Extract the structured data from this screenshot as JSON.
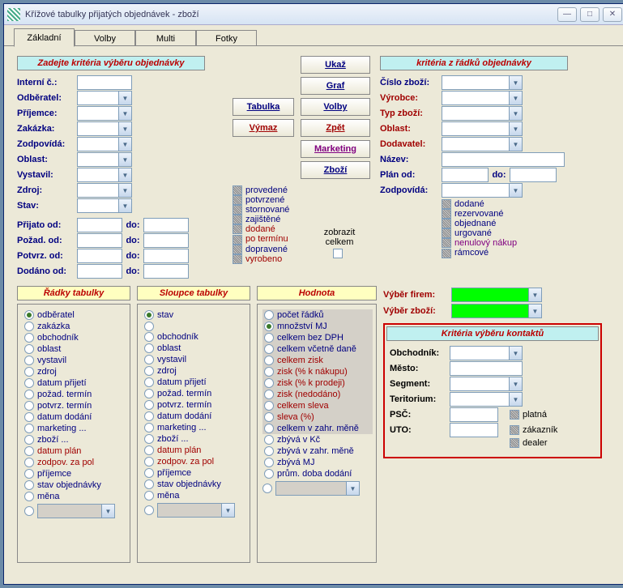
{
  "title": "Křížové tabulky přijatých objednávek - zboží",
  "tabs": [
    "Základní",
    "Volby",
    "Multi",
    "Fotky"
  ],
  "hdr_left": "Zadejte kritéria výběru objednávky",
  "hdr_right": "kritéria z řádků objednávky",
  "btns": {
    "ukaz": "Ukaž",
    "graf": "Graf",
    "tabulka": "Tabulka",
    "volby": "Volby",
    "vymaz": "Výmaz",
    "zpet": "Zpět",
    "marketing": "Marketing",
    "zbozi": "Zboží"
  },
  "left_labels": [
    "Interní č.:",
    "Odběratel:",
    "Příjemce:",
    "Zakázka:",
    "Zodpovídá:",
    "Oblast:",
    "Vystavil:",
    "Zdroj:",
    "Stav:"
  ],
  "date_labels": [
    "Přijato od:",
    "Požad. od:",
    "Potvrz. od:",
    "Dodáno od:"
  ],
  "do": "do:",
  "mid_checks": [
    "provedené",
    "potvrzené",
    "stornované",
    "zajištěné",
    "dodané",
    "po termínu",
    "dopravené",
    "vyrobeno"
  ],
  "zobrazit": "zobrazit celkem",
  "right_labels": [
    "Číslo zboží:",
    "Výrobce:",
    "Typ zboží:",
    "Oblast:",
    "Dodavatel:",
    "Název:",
    "Plán od:",
    "Zodpovídá:"
  ],
  "right_checks": [
    "dodané",
    "rezervované",
    "objednané",
    "urgované",
    "nenulový nákup",
    "rámcové"
  ],
  "col_hdr": [
    "Řádky tabulky",
    "Sloupce tabulky",
    "Hodnota"
  ],
  "vyber_firem": "Výběr firem:",
  "vyber_zbozi": "Výběr zboží:",
  "radky": [
    "odběratel",
    "zakázka",
    "obchodník",
    "oblast",
    "vystavil",
    "zdroj",
    "datum přijetí",
    "požad. termín",
    "potvrz. termín",
    "datum dodání",
    "marketing ...",
    "zboží ...",
    "datum plán",
    "zodpov. za pol",
    "příjemce",
    "stav objednávky",
    "měna"
  ],
  "sloupce": [
    "stav",
    "",
    "obchodník",
    "oblast",
    "vystavil",
    "zdroj",
    "datum přijetí",
    "požad. termín",
    "potvrz. termín",
    "datum dodání",
    "marketing ...",
    "zboží ...",
    "datum plán",
    "zodpov. za pol",
    "příjemce",
    "stav objednávky",
    "měna"
  ],
  "hodnota": [
    "počet řádků",
    "množství MJ",
    "celkem bez DPH",
    "celkem včetně daně",
    "celkem zisk",
    "zisk (% k nákupu)",
    "zisk (% k prodeji)",
    "zisk (nedodáno)",
    "celkem sleva",
    "sleva (%)",
    "celkem v zahr. měně",
    "zbývá v Kč",
    "zbývá v zahr. měně",
    "zbývá MJ",
    "prům. doba dodání"
  ],
  "kontakty_hdr": "Kritéria výběru kontaktů",
  "kontakty_labels": [
    "Obchodník:",
    "Město:",
    "Segment:",
    "Teritorium:",
    "PSČ:",
    "UTO:"
  ],
  "kontakty_chk": [
    "platná",
    "zákazník",
    "dealer"
  ]
}
